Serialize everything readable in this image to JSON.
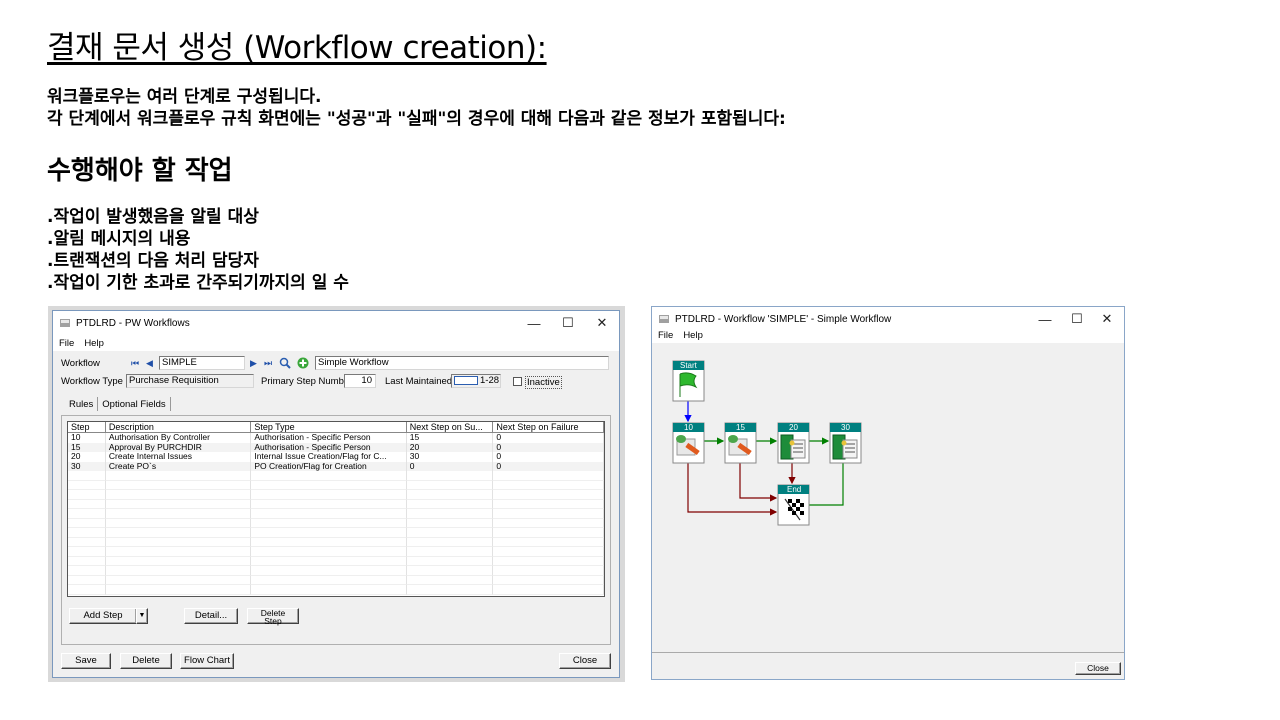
{
  "slide": {
    "title": "결재 문서 생성 (Workflow creation):",
    "intro_lines": [
      "워크플로우는 여러 단계로 구성됩니다.",
      "각 단계에서 워크플로우 규칙 화면에는 \"성공\"과 \"실패\"의 경우에 대해 다음과 같은 정보가 포함됩니다:"
    ],
    "section_heading": "수행해야 할 작업",
    "bullets": [
      ".작업이 발생했음을 알릴 대상",
      ".알림 메시지의 내용",
      ".트랜잭션의 다음 처리 담당자",
      ".작업이 기한 초과로 간주되기까지의 일 수"
    ]
  },
  "pw_window": {
    "title": "PTDLRD - PW Workflows",
    "menu": [
      "File",
      "Help"
    ],
    "controls": {
      "minimize": "—",
      "maximize": "☐",
      "close": "✕"
    },
    "workflow_label": "Workflow",
    "workflow_code": "SIMPLE",
    "workflow_name": "Simple Workflow",
    "workflow_type_label": "Workflow Type",
    "workflow_type_value": "Purchase Requisition",
    "primary_step_label": "Primary Step Numbe",
    "primary_step_value": "10",
    "last_maintained_label": "Last Maintained",
    "last_maintained_value": "1-28",
    "inactive_label": "Inactive",
    "tabs": [
      "Rules",
      "Optional Fields"
    ],
    "grid": {
      "headers": [
        "Step",
        "Description",
        "Step Type",
        "Next Step on Su...",
        "Next Step on Failure"
      ],
      "rows": [
        [
          "10",
          "Authorisation By Controller",
          "Authorisation - Specific Person",
          "15",
          "0"
        ],
        [
          "15",
          "Approval By PURCHDIR",
          "Authorisation - Specific Person",
          "20",
          "0"
        ],
        [
          "20",
          "Create Internal Issues",
          "Internal Issue Creation/Flag for C...",
          "30",
          "0"
        ],
        [
          "30",
          "Create PO`s",
          "PO Creation/Flag for Creation",
          "0",
          "0"
        ]
      ]
    },
    "buttons": {
      "add_step": "Add Step",
      "add_step_arrow": "▼",
      "detail": "Detail...",
      "delete_step_line1": "Delete",
      "delete_step_line2": "Step",
      "save": "Save",
      "delete": "Delete",
      "flow_chart": "Flow Chart",
      "close": "Close"
    }
  },
  "flow_window": {
    "title": "PTDLRD -   Workflow 'SIMPLE' - Simple Workflow",
    "menu": [
      "File",
      "Help"
    ],
    "controls": {
      "minimize": "—",
      "maximize": "☐",
      "close": "✕"
    },
    "nodes": {
      "start": "Start",
      "s10": "10",
      "s15": "15",
      "s20": "20",
      "s30": "30",
      "end": "End"
    },
    "close_button": "Close",
    "colors": {
      "node_header": "#008080",
      "success_arrow": "#008000",
      "failure_arrow": "#800000",
      "start_arrow": "#0000ff"
    }
  }
}
